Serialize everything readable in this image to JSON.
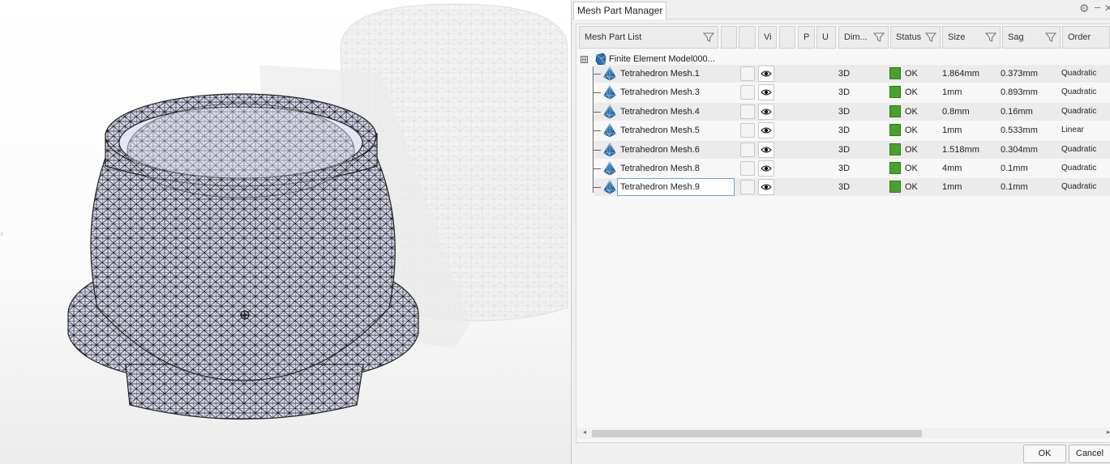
{
  "panel": {
    "title": "Mesh Part Manager",
    "icons": {
      "settings": "gear-icon",
      "minimize": "minimize-icon",
      "close": "close-icon"
    }
  },
  "columns": [
    {
      "label": "Mesh Part List",
      "filter": true
    },
    {
      "label": "",
      "filter": false
    },
    {
      "label": "",
      "filter": false
    },
    {
      "label": "Vi",
      "filter": false
    },
    {
      "label": "",
      "filter": false
    },
    {
      "label": "P",
      "filter": false
    },
    {
      "label": "U",
      "filter": false
    },
    {
      "label": "Dim...",
      "filter": true
    },
    {
      "label": "Status",
      "filter": true
    },
    {
      "label": "Size",
      "filter": true
    },
    {
      "label": "Sag",
      "filter": true
    },
    {
      "label": "Order",
      "filter": false
    }
  ],
  "tree": {
    "root_label": "Finite Element Model000...",
    "expander": "⊟",
    "rows": [
      {
        "name": "Tetrahedron Mesh.1",
        "dim": "3D",
        "status": "OK",
        "size": "1.864mm",
        "sag": "0.373mm",
        "order": "Quadratic"
      },
      {
        "name": "Tetrahedron Mesh.3",
        "dim": "3D",
        "status": "OK",
        "size": "1mm",
        "sag": "0.893mm",
        "order": "Quadratic"
      },
      {
        "name": "Tetrahedron Mesh.4",
        "dim": "3D",
        "status": "OK",
        "size": "0.8mm",
        "sag": "0.16mm",
        "order": "Quadratic"
      },
      {
        "name": "Tetrahedron Mesh.5",
        "dim": "3D",
        "status": "OK",
        "size": "1mm",
        "sag": "0.533mm",
        "order": "Linear"
      },
      {
        "name": "Tetrahedron Mesh.6",
        "dim": "3D",
        "status": "OK",
        "size": "1.518mm",
        "sag": "0.304mm",
        "order": "Quadratic"
      },
      {
        "name": "Tetrahedron Mesh.8",
        "dim": "3D",
        "status": "OK",
        "size": "4mm",
        "sag": "0.1mm",
        "order": "Quadratic"
      },
      {
        "name": "Tetrahedron Mesh.9",
        "dim": "3D",
        "status": "OK",
        "size": "1mm",
        "sag": "0.1mm",
        "order": "Quadratic",
        "selected": true
      }
    ]
  },
  "buttons": {
    "ok": "OK",
    "cancel": "Cancel"
  },
  "colors": {
    "status_ok": "#4aa02c",
    "mesh_icon": "#2a6fb0",
    "mesh_surface": "#c9cde6"
  }
}
